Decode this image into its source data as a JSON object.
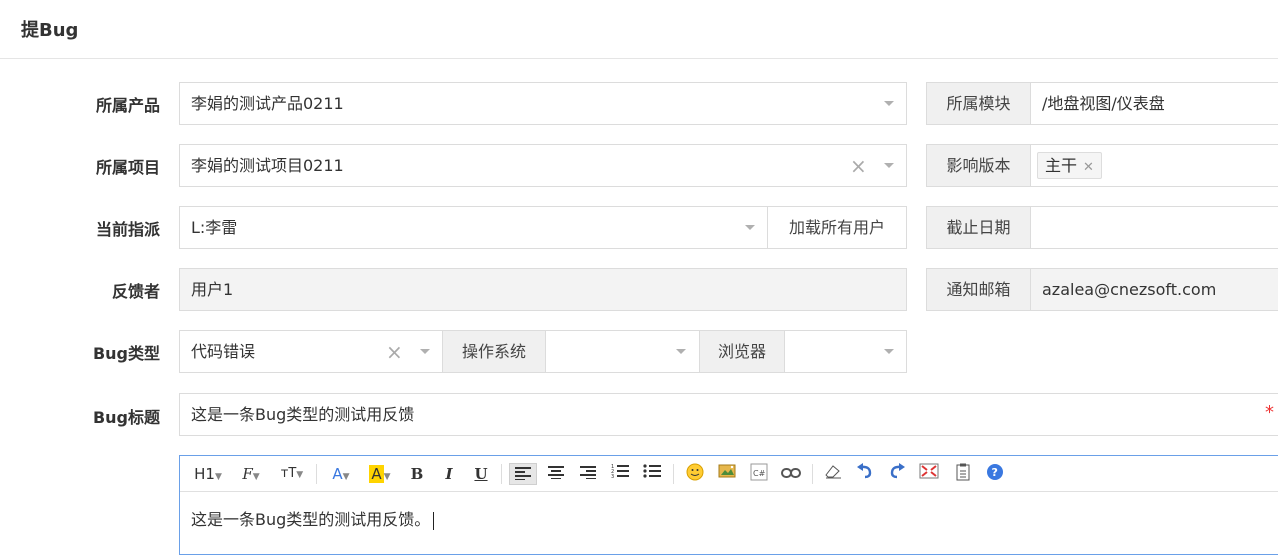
{
  "page": {
    "title": "提Bug"
  },
  "form": {
    "product": {
      "label": "所属产品",
      "value": "李娟的测试产品0211"
    },
    "module": {
      "label": "所属模块",
      "value": "/地盘视图/仪表盘"
    },
    "project": {
      "label": "所属项目",
      "value": "李娟的测试项目0211"
    },
    "build": {
      "label": "影响版本",
      "chip": "主干"
    },
    "assigned": {
      "label": "当前指派",
      "value": "L:李雷",
      "load_all_label": "加载所有用户"
    },
    "deadline": {
      "label": "截止日期",
      "value": ""
    },
    "feedback_by": {
      "label": "反馈者",
      "value": "用户1"
    },
    "notify_email": {
      "label": "通知邮箱",
      "value": "azalea@cnezsoft.com"
    },
    "bug_type": {
      "label": "Bug类型",
      "value": "代码错误"
    },
    "os": {
      "label": "操作系统",
      "value": ""
    },
    "browser": {
      "label": "浏览器",
      "value": ""
    },
    "bug_title": {
      "label": "Bug标题",
      "value": "这是一条Bug类型的测试用反馈",
      "required_mark": "*"
    }
  },
  "editor": {
    "toolbar": {
      "h1": "H1",
      "font_family": "F",
      "font_size": "тT",
      "font_color": "A",
      "bg_color": "A",
      "bold": "B",
      "italic": "I",
      "underline": "U"
    },
    "content": "这是一条Bug类型的测试用反馈。"
  },
  "colors": {
    "accent": "#3a78e0",
    "required": "#e33333",
    "addon_bg": "#f0f0f0"
  }
}
